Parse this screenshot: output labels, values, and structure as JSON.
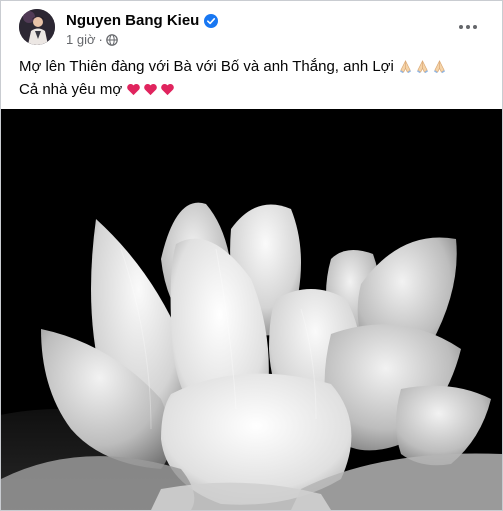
{
  "post": {
    "author_name": "Nguyen Bang Kieu",
    "timestamp": "1 giờ",
    "privacy_icon": "globe-icon",
    "verified_icon": "verified-badge-icon",
    "more_icon": "more-options-icon",
    "text_line_1": "Mợ lên Thiên đàng với Bà với Bố và anh Thắng, anh Lợi",
    "text_line_1_emoji": [
      "folded-hands-icon",
      "folded-hands-icon",
      "folded-hands-icon"
    ],
    "text_line_2": "Cả nhà yêu mợ",
    "text_line_2_emoji": [
      "red-heart-icon",
      "red-heart-icon",
      "red-heart-icon"
    ]
  },
  "colors": {
    "accent_blue": "#1877f2",
    "secondary_text": "#65676b",
    "heart_red": "#e0245e",
    "photo_background": "#000000"
  }
}
